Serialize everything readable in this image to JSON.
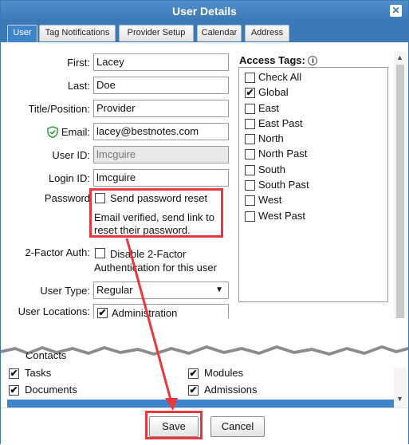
{
  "title": "User Details",
  "close_glyph": "✕",
  "tabs": [
    "User",
    "Tag Notifications",
    "Provider Setup",
    "Calendar",
    "Address"
  ],
  "form": {
    "first_label": "First:",
    "first_value": "Lacey",
    "last_label": "Last:",
    "last_value": "Doe",
    "title_label": "Title/Position:",
    "title_value": "Provider",
    "email_label": "Email:",
    "email_value": "lacey@bestnotes.com",
    "userid_label": "User ID:",
    "userid_value": "lmcguire",
    "loginid_label": "Login ID:",
    "loginid_value": "lmcguire",
    "password_label": "Password",
    "send_reset_label": "Send password reset",
    "reset_note": "Email verified, send link to reset their password.",
    "twofactor_label": "2-Factor Auth:",
    "twofactor_text": "Disable 2-Factor Authentication for this user",
    "usertype_label": "User Type:",
    "usertype_value": "Regular",
    "locations_label": "User Locations:",
    "location_first": "Administration"
  },
  "access_tags": {
    "label": "Access Tags:",
    "items": [
      {
        "label": "Check All",
        "checked": false
      },
      {
        "label": "Global",
        "checked": true
      },
      {
        "label": "East",
        "checked": false
      },
      {
        "label": "East Past",
        "checked": false
      },
      {
        "label": "North",
        "checked": false
      },
      {
        "label": "North Past",
        "checked": false
      },
      {
        "label": "South",
        "checked": false
      },
      {
        "label": "South Past",
        "checked": false
      },
      {
        "label": "West",
        "checked": false
      },
      {
        "label": "West Past",
        "checked": false
      }
    ]
  },
  "permissions": {
    "partial_left": "Contacts",
    "tasks": "Tasks",
    "documents": "Documents",
    "modules": "Modules",
    "admissions": "Admissions"
  },
  "footer": {
    "save_label": "Save",
    "cancel_label": "Cancel"
  },
  "colors": {
    "titlebar": "#3a78b8",
    "active_tab": "#3f85cc",
    "annotation_red": "#e8383d",
    "verified_green": "#2e9b3d"
  }
}
